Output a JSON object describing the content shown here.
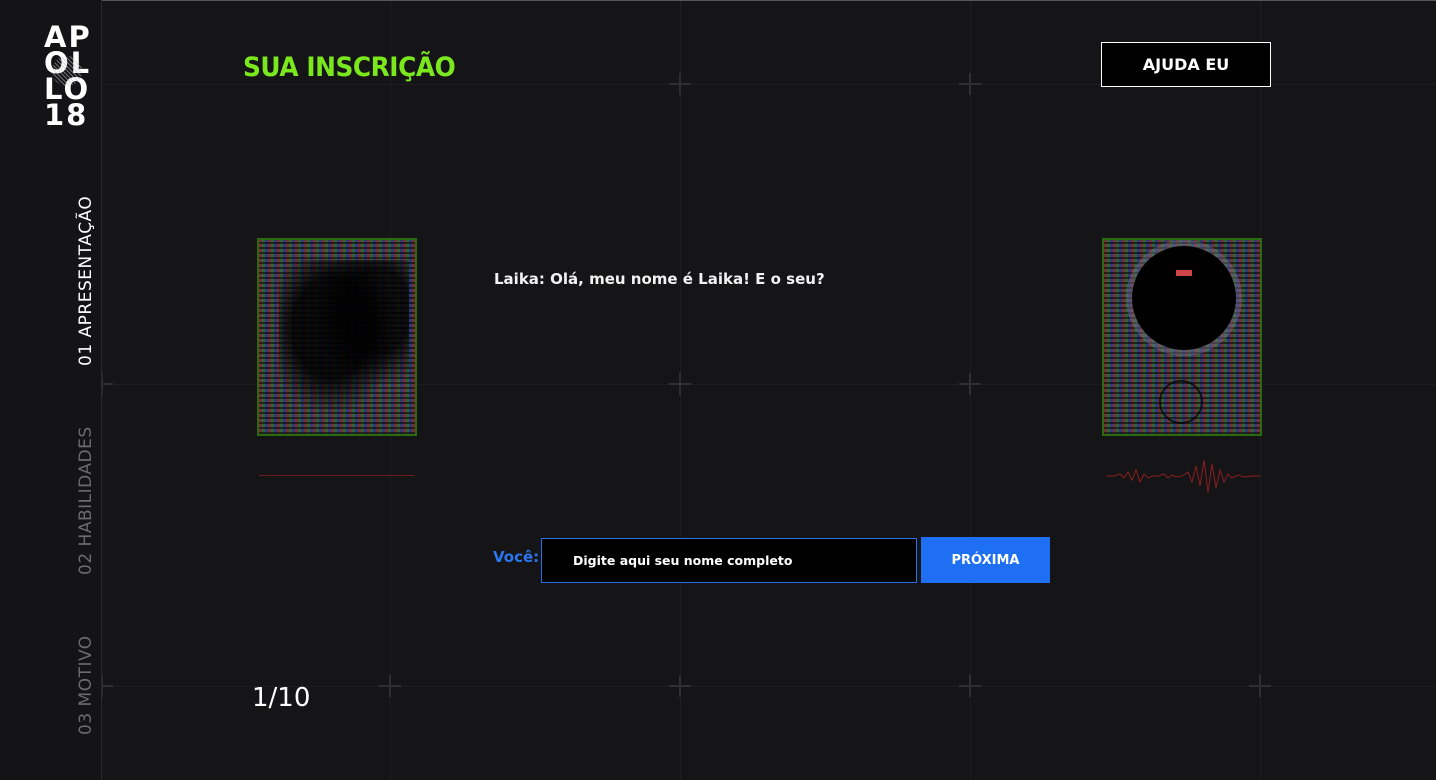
{
  "brand": {
    "logo_lines": [
      "AP",
      "OL",
      "LO",
      "18"
    ]
  },
  "sidebar": {
    "items": [
      {
        "label": "01 APRESENTAÇÃO",
        "active": true
      },
      {
        "label": "02 HABILIDADES",
        "active": false
      },
      {
        "label": "03 MOTIVO",
        "active": false
      }
    ]
  },
  "header": {
    "title": "SUA INSCRIÇÃO",
    "help_label": "AJUDA EU"
  },
  "chat": {
    "message": "Laika: Olá, meu nome é Laika! E o seu?",
    "you_label": "Você:",
    "input_placeholder": "Digite aqui seu nome completo",
    "input_value": "",
    "next_label": "PRÓXIMA"
  },
  "progress": {
    "text": "1/10",
    "current": 1,
    "total": 10
  },
  "colors": {
    "accent_green": "#7be81d",
    "accent_blue": "#1f6ff2",
    "background": "#151416",
    "wave_red": "#8a1f1f"
  },
  "icons": {
    "left_avatar": "laika-dog-portrait",
    "right_avatar": "astronaut-helmet-portrait"
  }
}
